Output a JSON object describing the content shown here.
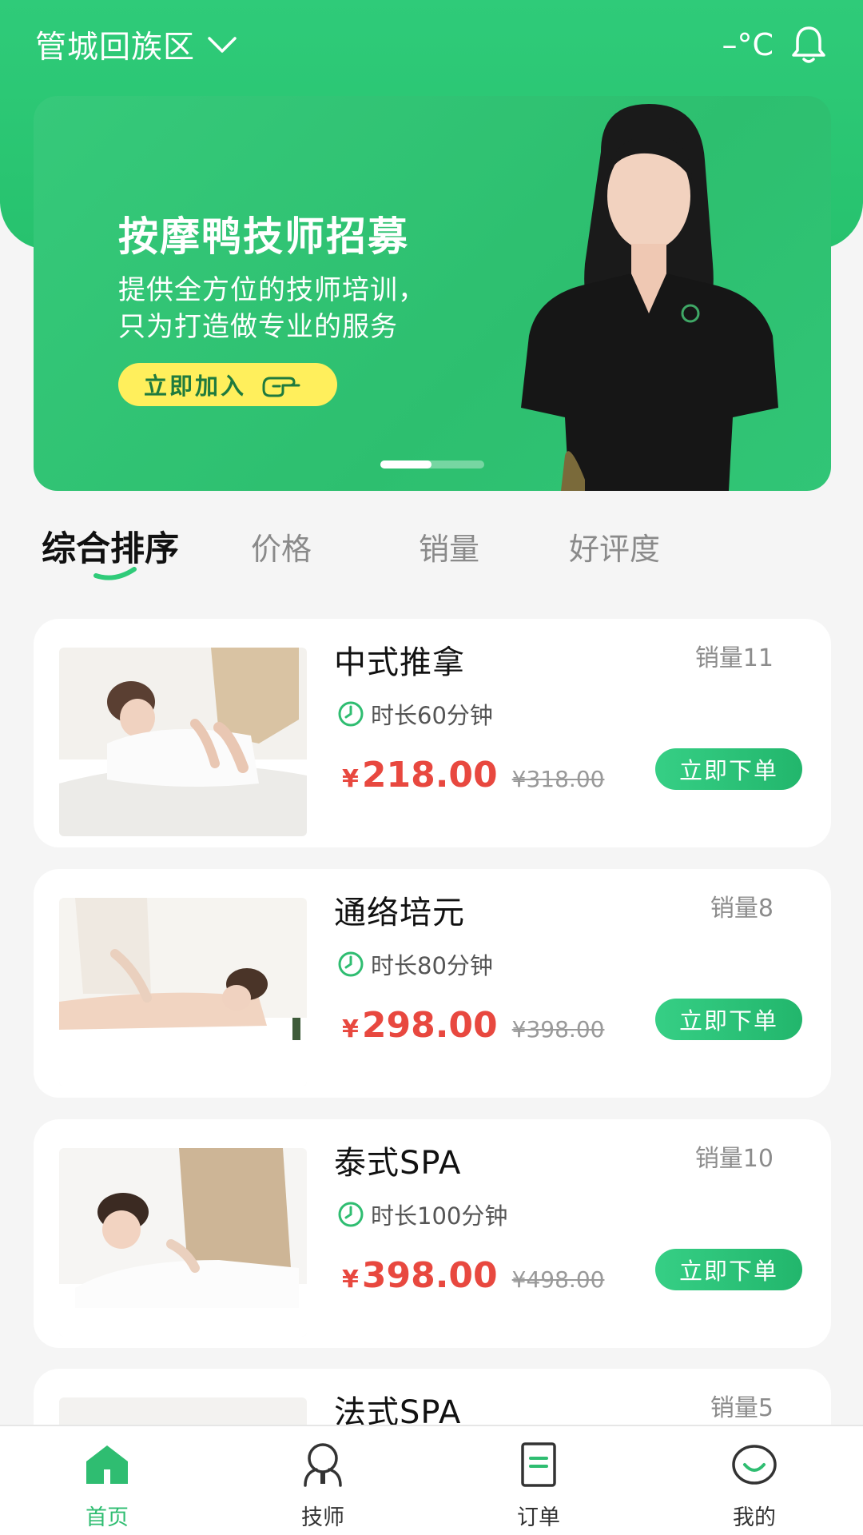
{
  "header": {
    "location": "管城回族区",
    "temperature": "–°C"
  },
  "banner": {
    "title": "按摩鸭技师招募",
    "subtitle_line1": "提供全方位的技师培训，",
    "subtitle_line2": "只为打造做专业的服务",
    "button_label": "立即加入",
    "slide_index": 1,
    "slide_count": 2
  },
  "sort_tabs": [
    "综合排序",
    "价格",
    "销量",
    "好评度"
  ],
  "services": [
    {
      "title": "中式推拿",
      "sales": "销量11",
      "duration": "时长60分钟",
      "currency": "¥",
      "price": "218.00",
      "original_price": "¥318.00",
      "order_label": "立即下单"
    },
    {
      "title": "通络培元",
      "sales": "销量8",
      "duration": "时长80分钟",
      "currency": "¥",
      "price": "298.00",
      "original_price": "¥398.00",
      "order_label": "立即下单"
    },
    {
      "title": "泰式SPA",
      "sales": "销量10",
      "duration": "时长100分钟",
      "currency": "¥",
      "price": "398.00",
      "original_price": "¥498.00",
      "order_label": "立即下单"
    },
    {
      "title": "法式SPA",
      "sales": "销量5"
    }
  ],
  "bottom_nav": [
    {
      "label": "首页",
      "icon": "home-icon",
      "active": true
    },
    {
      "label": "技师",
      "icon": "technician-icon",
      "active": false
    },
    {
      "label": "订单",
      "icon": "order-icon",
      "active": false
    },
    {
      "label": "我的",
      "icon": "profile-icon",
      "active": false
    }
  ],
  "colors": {
    "brand_green": "#2fcb79",
    "price_red": "#e8483f",
    "banner_button": "#ffef5c"
  }
}
